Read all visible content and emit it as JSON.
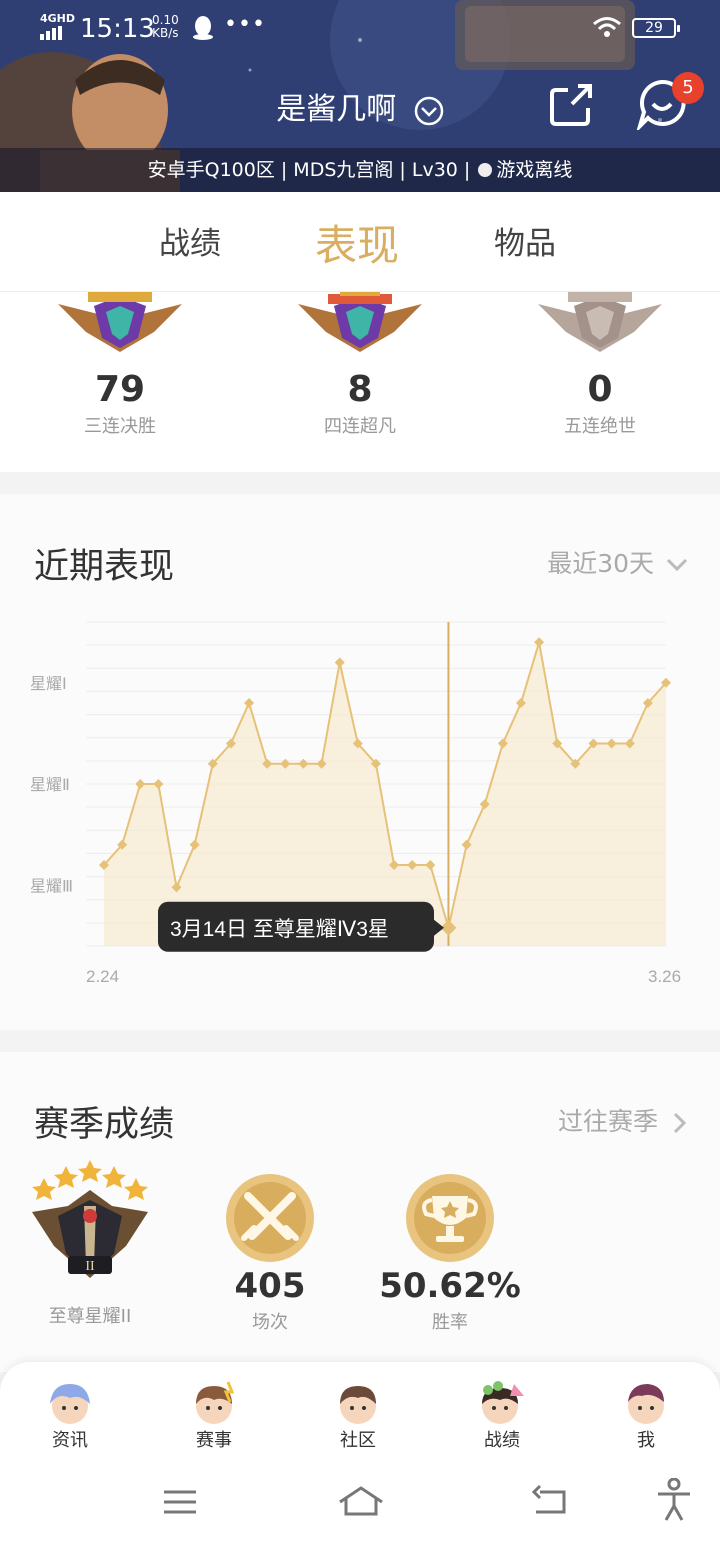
{
  "status_bar": {
    "network": "4GHD",
    "time": "15:13",
    "speed_value": "0.10",
    "speed_unit": "KB/s",
    "more": "•••",
    "battery": "29"
  },
  "header": {
    "player_name": "是酱几啊",
    "server_info": "安卓手Q100区 | MDS九宫阁 | Lv30 |",
    "online_status": "游戏离线",
    "message_badge": "5"
  },
  "tabs": [
    {
      "label": "战绩"
    },
    {
      "label": "表现"
    },
    {
      "label": "物品"
    }
  ],
  "active_tab": "表现",
  "achievements": [
    {
      "count": "79",
      "label": "三连决胜"
    },
    {
      "count": "8",
      "label": "四连超凡"
    },
    {
      "count": "0",
      "label": "五连绝世"
    }
  ],
  "recent": {
    "title": "近期表现",
    "period": "最近30天",
    "tooltip": "3月14日 至尊星耀Ⅳ3星"
  },
  "chart_data": {
    "type": "area",
    "x_start": "2.24",
    "x_end": "3.26",
    "tick_labels": [
      "星耀Ⅰ",
      "星耀Ⅱ",
      "星耀Ⅲ"
    ],
    "y_ticks": [
      {
        "label": "星耀Ⅰ",
        "value": 10
      },
      {
        "label": "星耀Ⅱ",
        "value": 5
      },
      {
        "label": "星耀Ⅲ",
        "value": 0
      }
    ],
    "ylim": [
      -3,
      13
    ],
    "values": [
      1.0,
      2.0,
      5.0,
      5.0,
      -0.1,
      2.0,
      6.0,
      7.0,
      9.0,
      6.0,
      6.0,
      6.0,
      6.0,
      11.0,
      7.0,
      6.0,
      1.0,
      1.0,
      1.0,
      -2.1,
      2.0,
      4.0,
      7.0,
      9.0,
      12.0,
      7.0,
      6.0,
      7.0,
      7.0,
      7.0,
      9.0,
      10.0
    ],
    "highlight_index": 19,
    "color": "#e6c178",
    "fill": "#f7ead0",
    "grid": true
  },
  "season": {
    "title": "赛季成绩",
    "link": "过往赛季",
    "rank_label": "至尊星耀II",
    "games_value": "405",
    "games_label": "场次",
    "winrate_value": "50.62%",
    "winrate_label": "胜率"
  },
  "bottom_nav": [
    {
      "label": "资讯"
    },
    {
      "label": "赛事"
    },
    {
      "label": "社区"
    },
    {
      "label": "战绩"
    },
    {
      "label": "我"
    }
  ],
  "colors": {
    "gold": "#d9ae62",
    "gold_light": "#e6c178",
    "badge_red": "#e8412c"
  }
}
